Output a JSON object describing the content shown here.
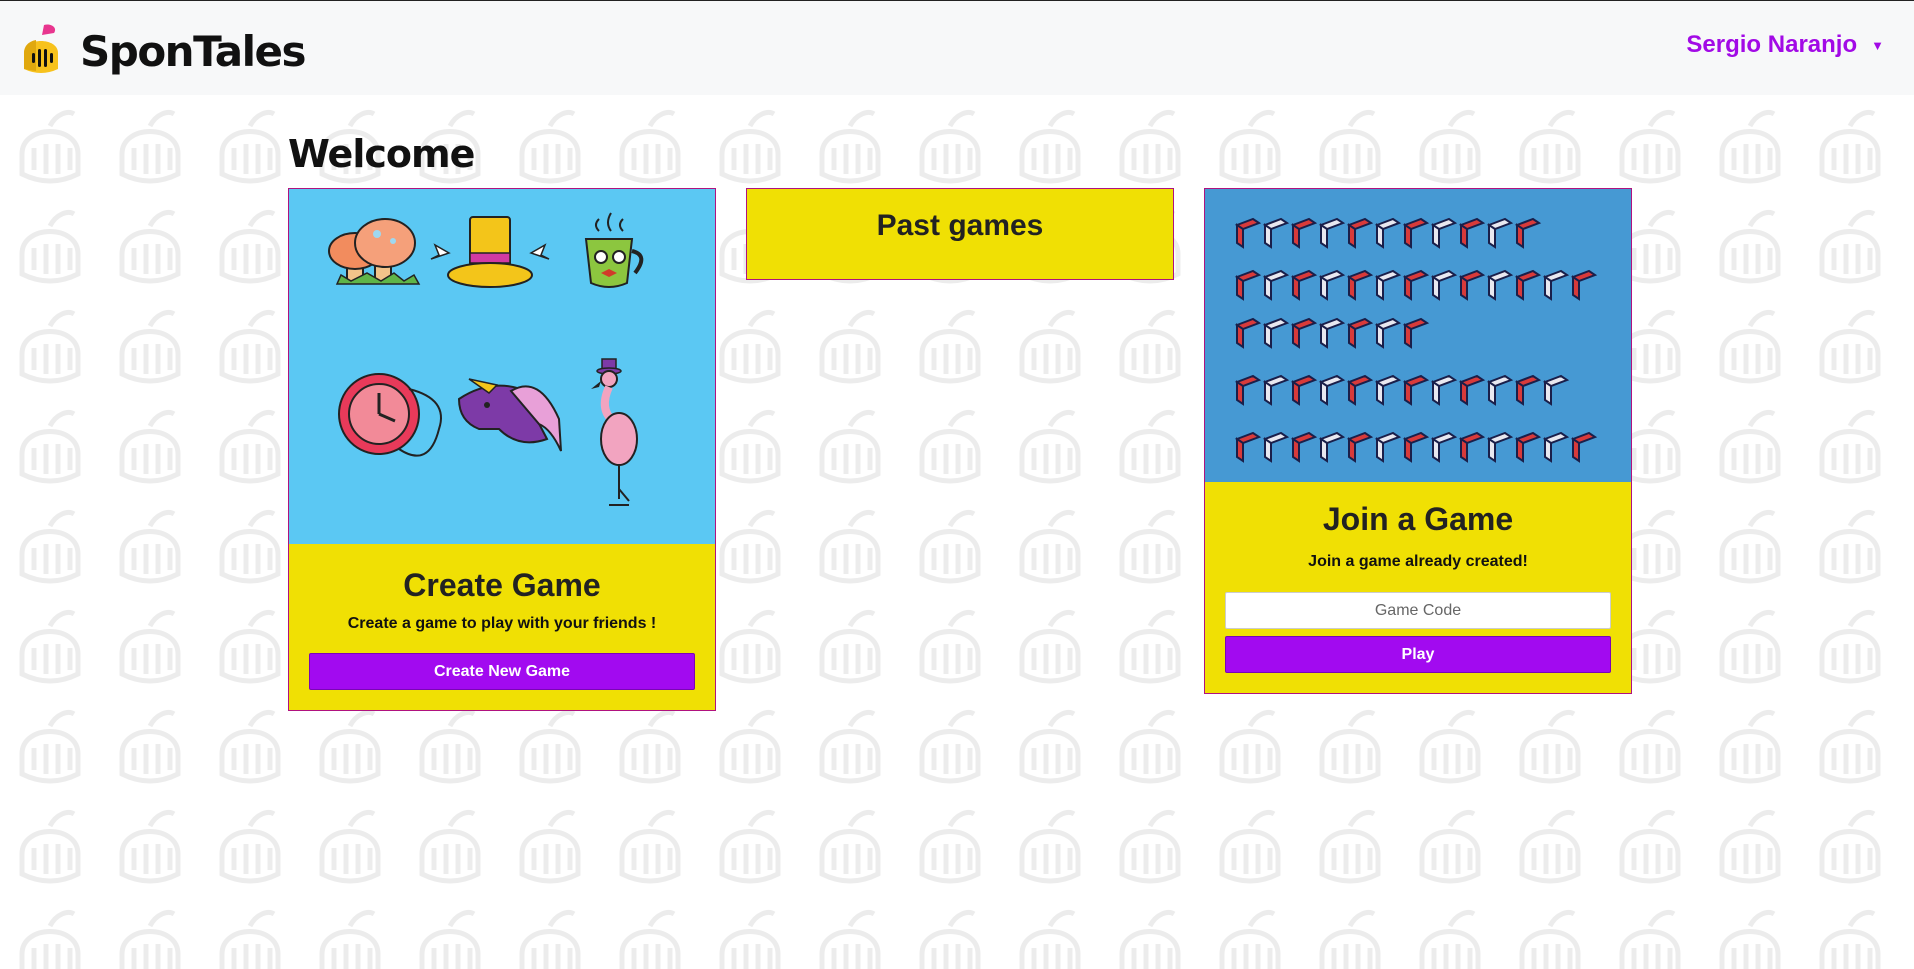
{
  "app": {
    "name": "SponTales"
  },
  "user": {
    "name": "Sergio Naranjo"
  },
  "page": {
    "title": "Welcome"
  },
  "create_card": {
    "title": "Create Game",
    "text": "Create a game to play with your friends !",
    "button": "Create New Game"
  },
  "past_card": {
    "title": "Past games"
  },
  "join_card": {
    "title": "Join a Game",
    "text": "Join a game already created!",
    "input_placeholder": "Game Code",
    "input_value": "",
    "button": "Play"
  },
  "colors": {
    "accent": "#a20af0",
    "card_yellow": "#f0e004",
    "create_bg": "#5bc8f3",
    "join_bg": "#4699d3",
    "border": "#b0127f"
  },
  "icons": [
    "spontales-logo-icon",
    "mushroom-icon",
    "top-hat-icon",
    "teacup-icon",
    "pocket-watch-icon",
    "unicorn-icon",
    "flamingo-icon",
    "isometric-alphabet-illustration",
    "dropdown-caret-icon"
  ]
}
